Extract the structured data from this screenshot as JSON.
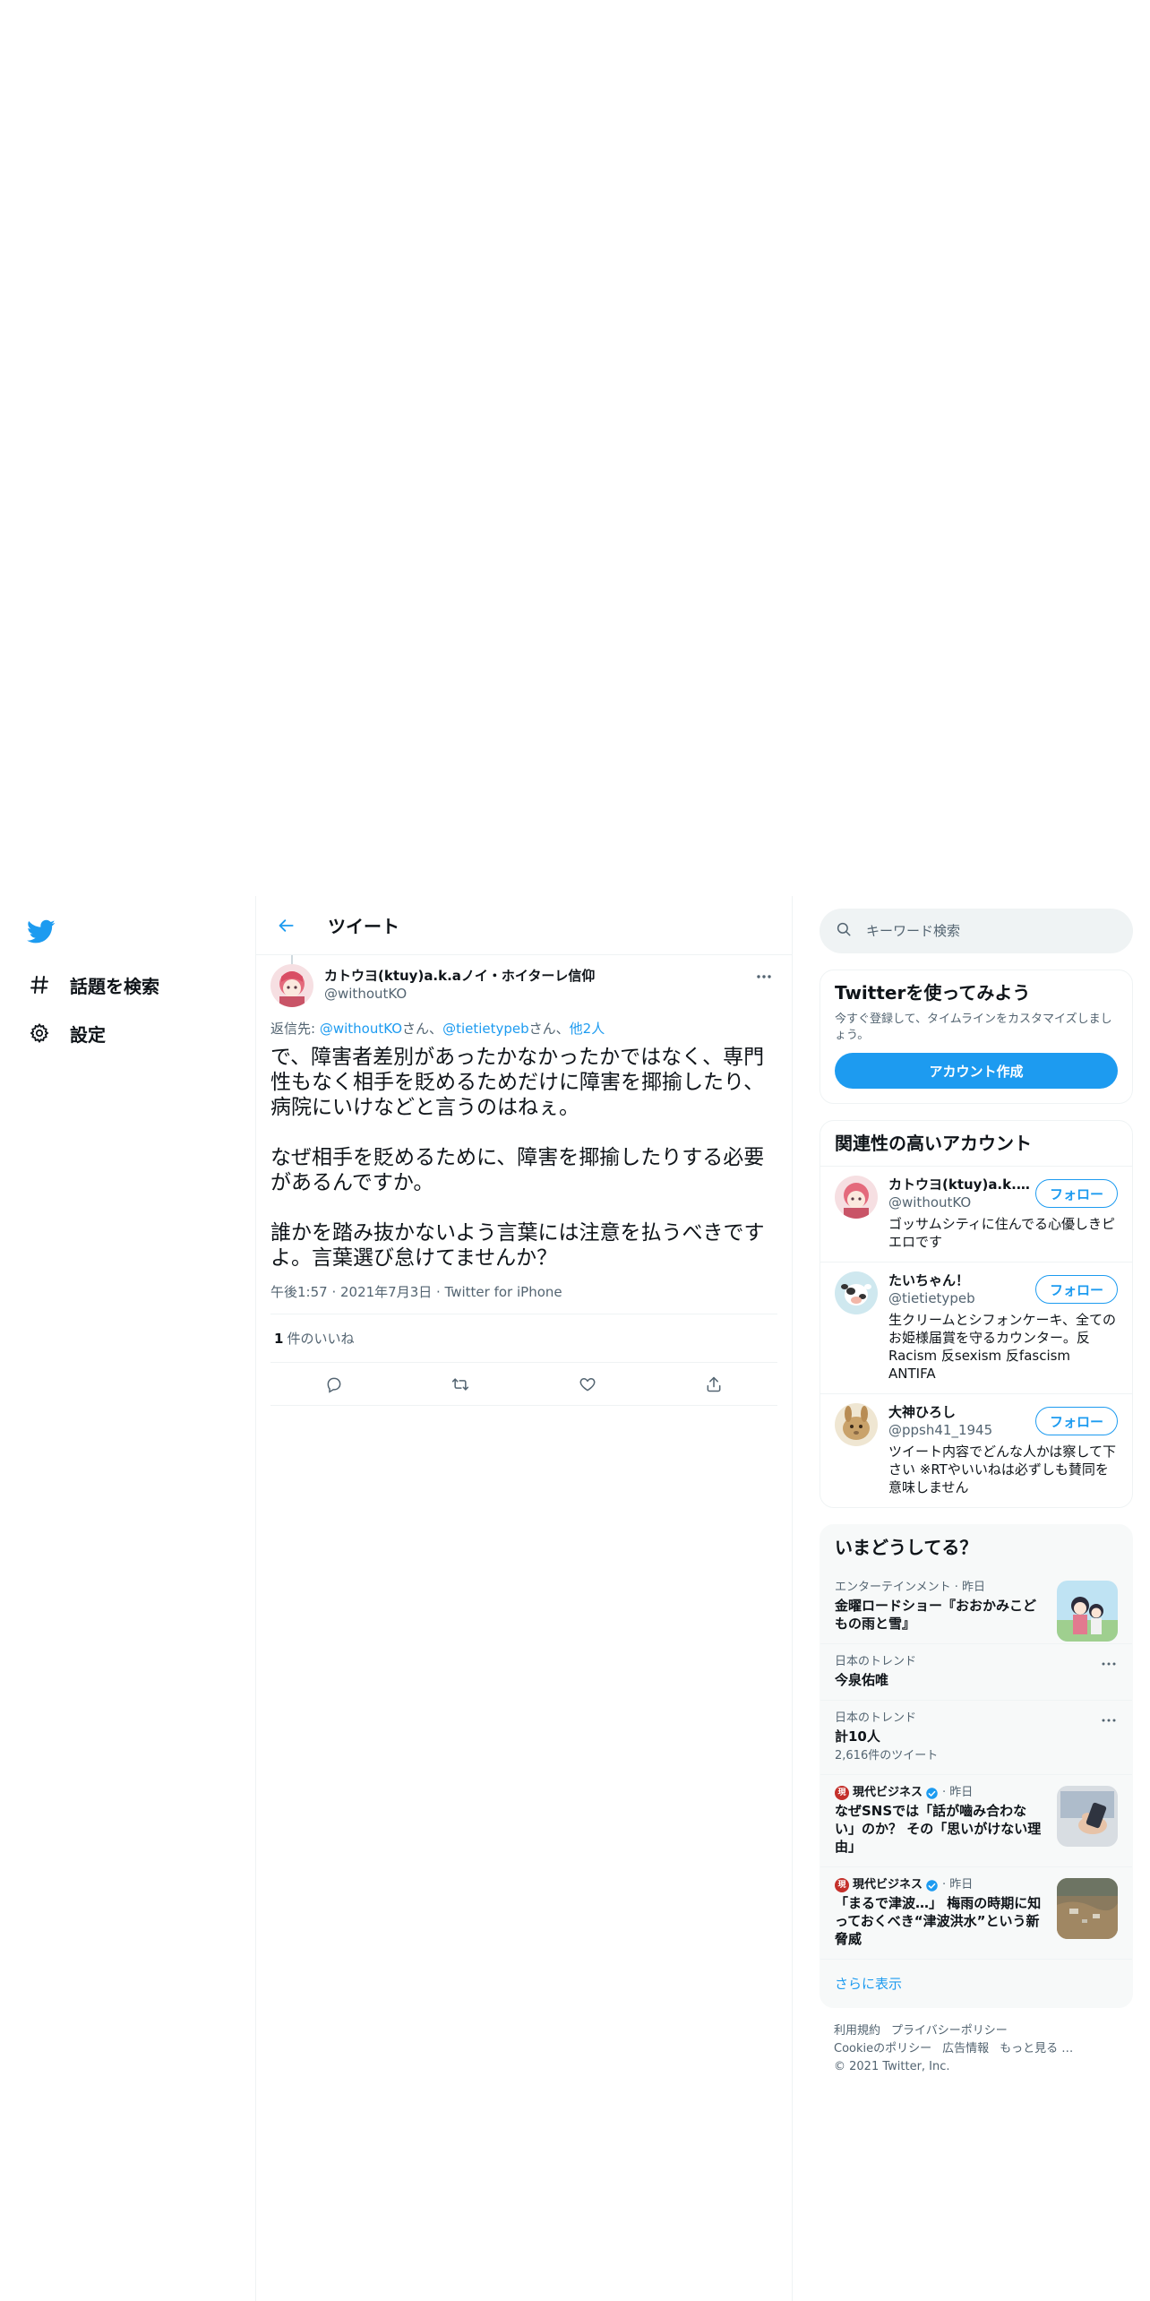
{
  "nav": {
    "items": [
      {
        "label": "話題を検索",
        "icon": "hash-icon"
      },
      {
        "label": "設定",
        "icon": "gear-icon"
      }
    ]
  },
  "header": {
    "title": "ツイート"
  },
  "tweet": {
    "display_name": "カトウヨ(ktuy)a.k.aノイ・ホイターレ信仰",
    "handle": "@withoutKO",
    "reply_prefix": "返信先: ",
    "reply_mentions": [
      "@withoutKO",
      "@tietietypeb"
    ],
    "reply_san": "さん、",
    "reply_san2": "さん、",
    "reply_others": "他2人",
    "text": "で、障害者差別があったかなかったかではなく、専門性もなく相手を貶めるためだけに障害を揶揄したり、病院にいけなどと言うのはねぇ。\n\nなぜ相手を貶めるために、障害を揶揄したりする必要があるんですか。\n\n誰かを踏み抜かないよう言葉には注意を払うべきですよ。言葉選び怠けてませんか？",
    "timestamp": "午後1:57 · 2021年7月3日 · Twitter for iPhone",
    "likes_count": "1",
    "likes_label": "件のいいね"
  },
  "search": {
    "placeholder": "キーワード検索"
  },
  "signup": {
    "title": "Twitterを使ってみよう",
    "desc": "今すぐ登録して、タイムラインをカスタマイズしましょう。",
    "button": "アカウント作成"
  },
  "related": {
    "title": "関連性の高いアカウント",
    "follow_label": "フォロー",
    "accounts": [
      {
        "name": "カトウヨ(ktuy)a.k.a...",
        "handle": "@withoutKO",
        "bio": "ゴッサムシティに住んでる心優しきピエロです"
      },
      {
        "name": "たいちゃん！",
        "handle": "@tietietypeb",
        "bio": "生クリームとシフォンケーキ、全てのお姫様届賞を守るカウンター。反Racism 反sexism 反fascism ANTIFA"
      },
      {
        "name": "大神ひろし",
        "handle": "@ppsh41_1945",
        "bio": "ツイート内容でどんな人かは察して下さい ※RTやいいねは必ずしも賛同を意味しません"
      }
    ]
  },
  "trends": {
    "title": "いまどうしてる？",
    "items": [
      {
        "context": "エンターテインメント · 昨日",
        "title": "金曜ロードショー『おおかみこどもの雨と雪』"
      },
      {
        "context": "日本のトレンド",
        "title": "今泉佑唯"
      },
      {
        "context": "日本のトレンド",
        "title": "計10人",
        "count": "2,616件のツイート"
      },
      {
        "publisher": "現代ビジネス",
        "time": "· 昨日",
        "title": "なぜSNSでは「話が嚙み合わない」のか？ その「思いがけない理由」"
      },
      {
        "publisher": "現代ビジネス",
        "time": "· 昨日",
        "title": "「まるで津波…」 梅雨の時期に知っておくべき“津波洪水”という新脅威"
      }
    ],
    "show_more": "さらに表示"
  },
  "footer": {
    "links": [
      "利用規約",
      "プライバシーポリシー",
      "Cookieのポリシー",
      "広告情報",
      "もっと見る …"
    ],
    "copyright": "© 2021 Twitter, Inc."
  },
  "colors": {
    "accent": "#1d9bf0",
    "text": "#0f1419",
    "muted": "#536471"
  }
}
